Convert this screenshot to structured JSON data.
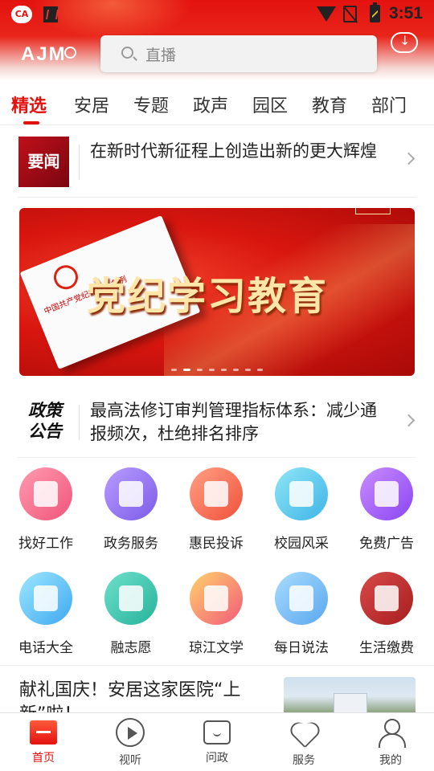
{
  "status_bar": {
    "time": "3:51"
  },
  "header": {
    "logo_text": "AJM",
    "search_placeholder": "直播"
  },
  "tabs": [
    {
      "label": "精选",
      "active": true
    },
    {
      "label": "安居"
    },
    {
      "label": "专题"
    },
    {
      "label": "政声"
    },
    {
      "label": "园区"
    },
    {
      "label": "教育"
    },
    {
      "label": "部门"
    }
  ],
  "headline": {
    "badge": "要闻",
    "text": "在新时代新征程上创造出新的更大辉煌"
  },
  "banner": {
    "title": "党纪学习教育",
    "book_title": "中国共产党纪律处分条例",
    "slide_count": 8,
    "active_slide": 2
  },
  "policy": {
    "badge_line1": "政策",
    "badge_line2": "公告",
    "text": "最高法修订审判管理指标体系：减少通报频次，杜绝排名排序"
  },
  "services": [
    {
      "label": "找好工作",
      "icon": "clipboard-icon",
      "color_from": "#ff9bb0",
      "color_to": "#f0547a"
    },
    {
      "label": "政务服务",
      "icon": "document-icon",
      "color_from": "#b89cff",
      "color_to": "#7b5ce8"
    },
    {
      "label": "惠民投诉",
      "icon": "people-icon",
      "color_from": "#ffa184",
      "color_to": "#f0503a"
    },
    {
      "label": "校园风采",
      "icon": "books-icon",
      "color_from": "#8fe6f5",
      "color_to": "#3fb4e8"
    },
    {
      "label": "免费广告",
      "icon": "thumbs-up-icon",
      "color_from": "#c98cff",
      "color_to": "#8a45f2"
    },
    {
      "label": "电话大全",
      "icon": "phone-icon",
      "color_from": "#9ee7ff",
      "color_to": "#3ea9f0"
    },
    {
      "label": "融志愿",
      "icon": "hand-icon",
      "color_from": "#6fe0cb",
      "color_to": "#26b39a"
    },
    {
      "label": "琼江文学",
      "icon": "open-book-icon",
      "color_from": "#ffd36b",
      "color_to": "#f25a7a"
    },
    {
      "label": "每日说法",
      "icon": "chat-bubble-icon",
      "color_from": "#a9dcff",
      "color_to": "#5aa7ee"
    },
    {
      "label": "生活缴费",
      "icon": "flame-icon",
      "color_from": "#d84a4a",
      "color_to": "#a61e1e"
    }
  ],
  "article": {
    "title": "献礼国庆！安居这家医院“上新”啦！"
  },
  "bottom_nav": [
    {
      "label": "首页",
      "icon": "home-icon",
      "active": true
    },
    {
      "label": "视听",
      "icon": "play-icon"
    },
    {
      "label": "问政",
      "icon": "chat-icon"
    },
    {
      "label": "服务",
      "icon": "heart-icon"
    },
    {
      "label": "我的",
      "icon": "user-icon"
    }
  ],
  "colors": {
    "accent": "#e3120f"
  }
}
